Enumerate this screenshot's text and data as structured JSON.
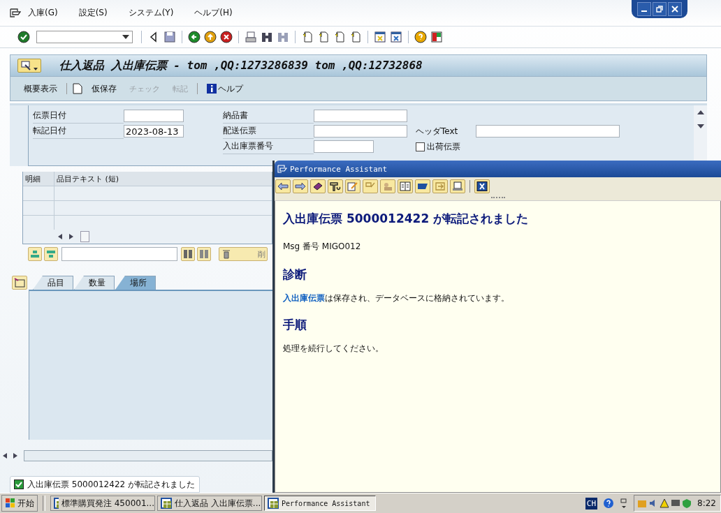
{
  "menu": [
    {
      "label": "入庫(G)"
    },
    {
      "label": "設定(S)"
    },
    {
      "label": "システム(Y)"
    },
    {
      "label": "ヘルプ(H)"
    }
  ],
  "screen_title": "仕入返品 入出庫伝票 - tom ,QQ:1273286839 tom ,QQ:12732868",
  "app_toolbar": [
    {
      "kind": "text",
      "label": "概要表示",
      "disabled": false
    },
    {
      "kind": "icon"
    },
    {
      "kind": "text",
      "label": "仮保存",
      "disabled": false
    },
    {
      "kind": "text",
      "label": "チェック",
      "disabled": true
    },
    {
      "kind": "text",
      "label": "転記",
      "disabled": true
    },
    {
      "kind": "info",
      "label": "ヘルプ",
      "disabled": false
    }
  ],
  "header_fields": [
    {
      "label": "伝票日付"
    },
    {
      "label": "転記日付",
      "value": "2023-08-13"
    }
  ],
  "document_fields": [
    {
      "label": "納品書"
    },
    {
      "label": "配送伝票"
    },
    {
      "label": "入出庫票番号"
    }
  ],
  "header_text": {
    "label": "ヘッダText"
  },
  "delivery_note_checkbox": {
    "label": "出荷伝票",
    "checked": false
  },
  "items_table": {
    "columns": [
      "明細",
      "品目テキスト (短)"
    ]
  },
  "delete_button": {
    "label": "削"
  },
  "tabs": [
    {
      "label": "品目",
      "selected": false
    },
    {
      "label": "数量",
      "selected": false
    },
    {
      "label": "場所",
      "selected": true
    }
  ],
  "status_message": {
    "text": "入出庫伝票 5000012422 が転記されました"
  },
  "assistant": {
    "title": "Performance Assistant",
    "heading": "入出庫伝票 5000012422 が転記されました",
    "msg_number": "Msg 番号 MIGO012",
    "sections": [
      {
        "heading": "診断",
        "link": "入出庫伝票",
        "text": "は保存され、データベースに格納されています。"
      },
      {
        "heading": "手順",
        "text": "処理を続行してください。"
      }
    ]
  },
  "taskbar": {
    "start": "开始",
    "tasks": [
      {
        "label": "標準購買発注 450001...",
        "selected": false
      },
      {
        "label": "仕入返品 入出庫伝票...",
        "selected": false
      },
      {
        "label": "Performance Assistant",
        "selected": true
      }
    ],
    "language": "CH",
    "time": "8:22"
  }
}
